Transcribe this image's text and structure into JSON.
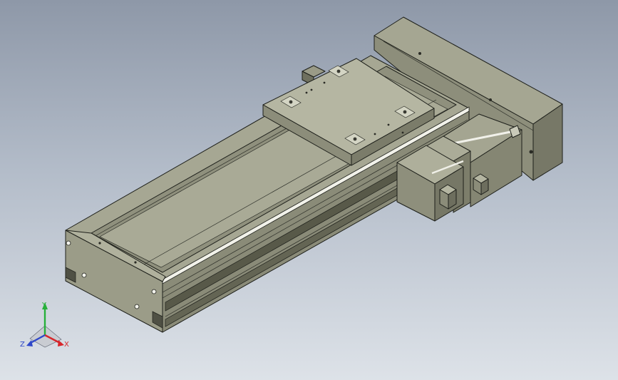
{
  "viewport": {
    "background_top": "#8e98a8",
    "background_bottom": "#dde2e8"
  },
  "model": {
    "body_color": "#9a9a86",
    "body_top_color": "#a8a995",
    "body_side_color": "#7f806e",
    "body_dark_color": "#5d5e50",
    "carriage_color": "#b7b7a4",
    "motor_color": "#96977f",
    "edge_color": "#1d1f1a"
  },
  "triad": {
    "x_label": "X",
    "y_label": "Y",
    "z_label": "Z",
    "x_color": "#d7262b",
    "y_color": "#27b03a",
    "z_color": "#2f48c9"
  }
}
